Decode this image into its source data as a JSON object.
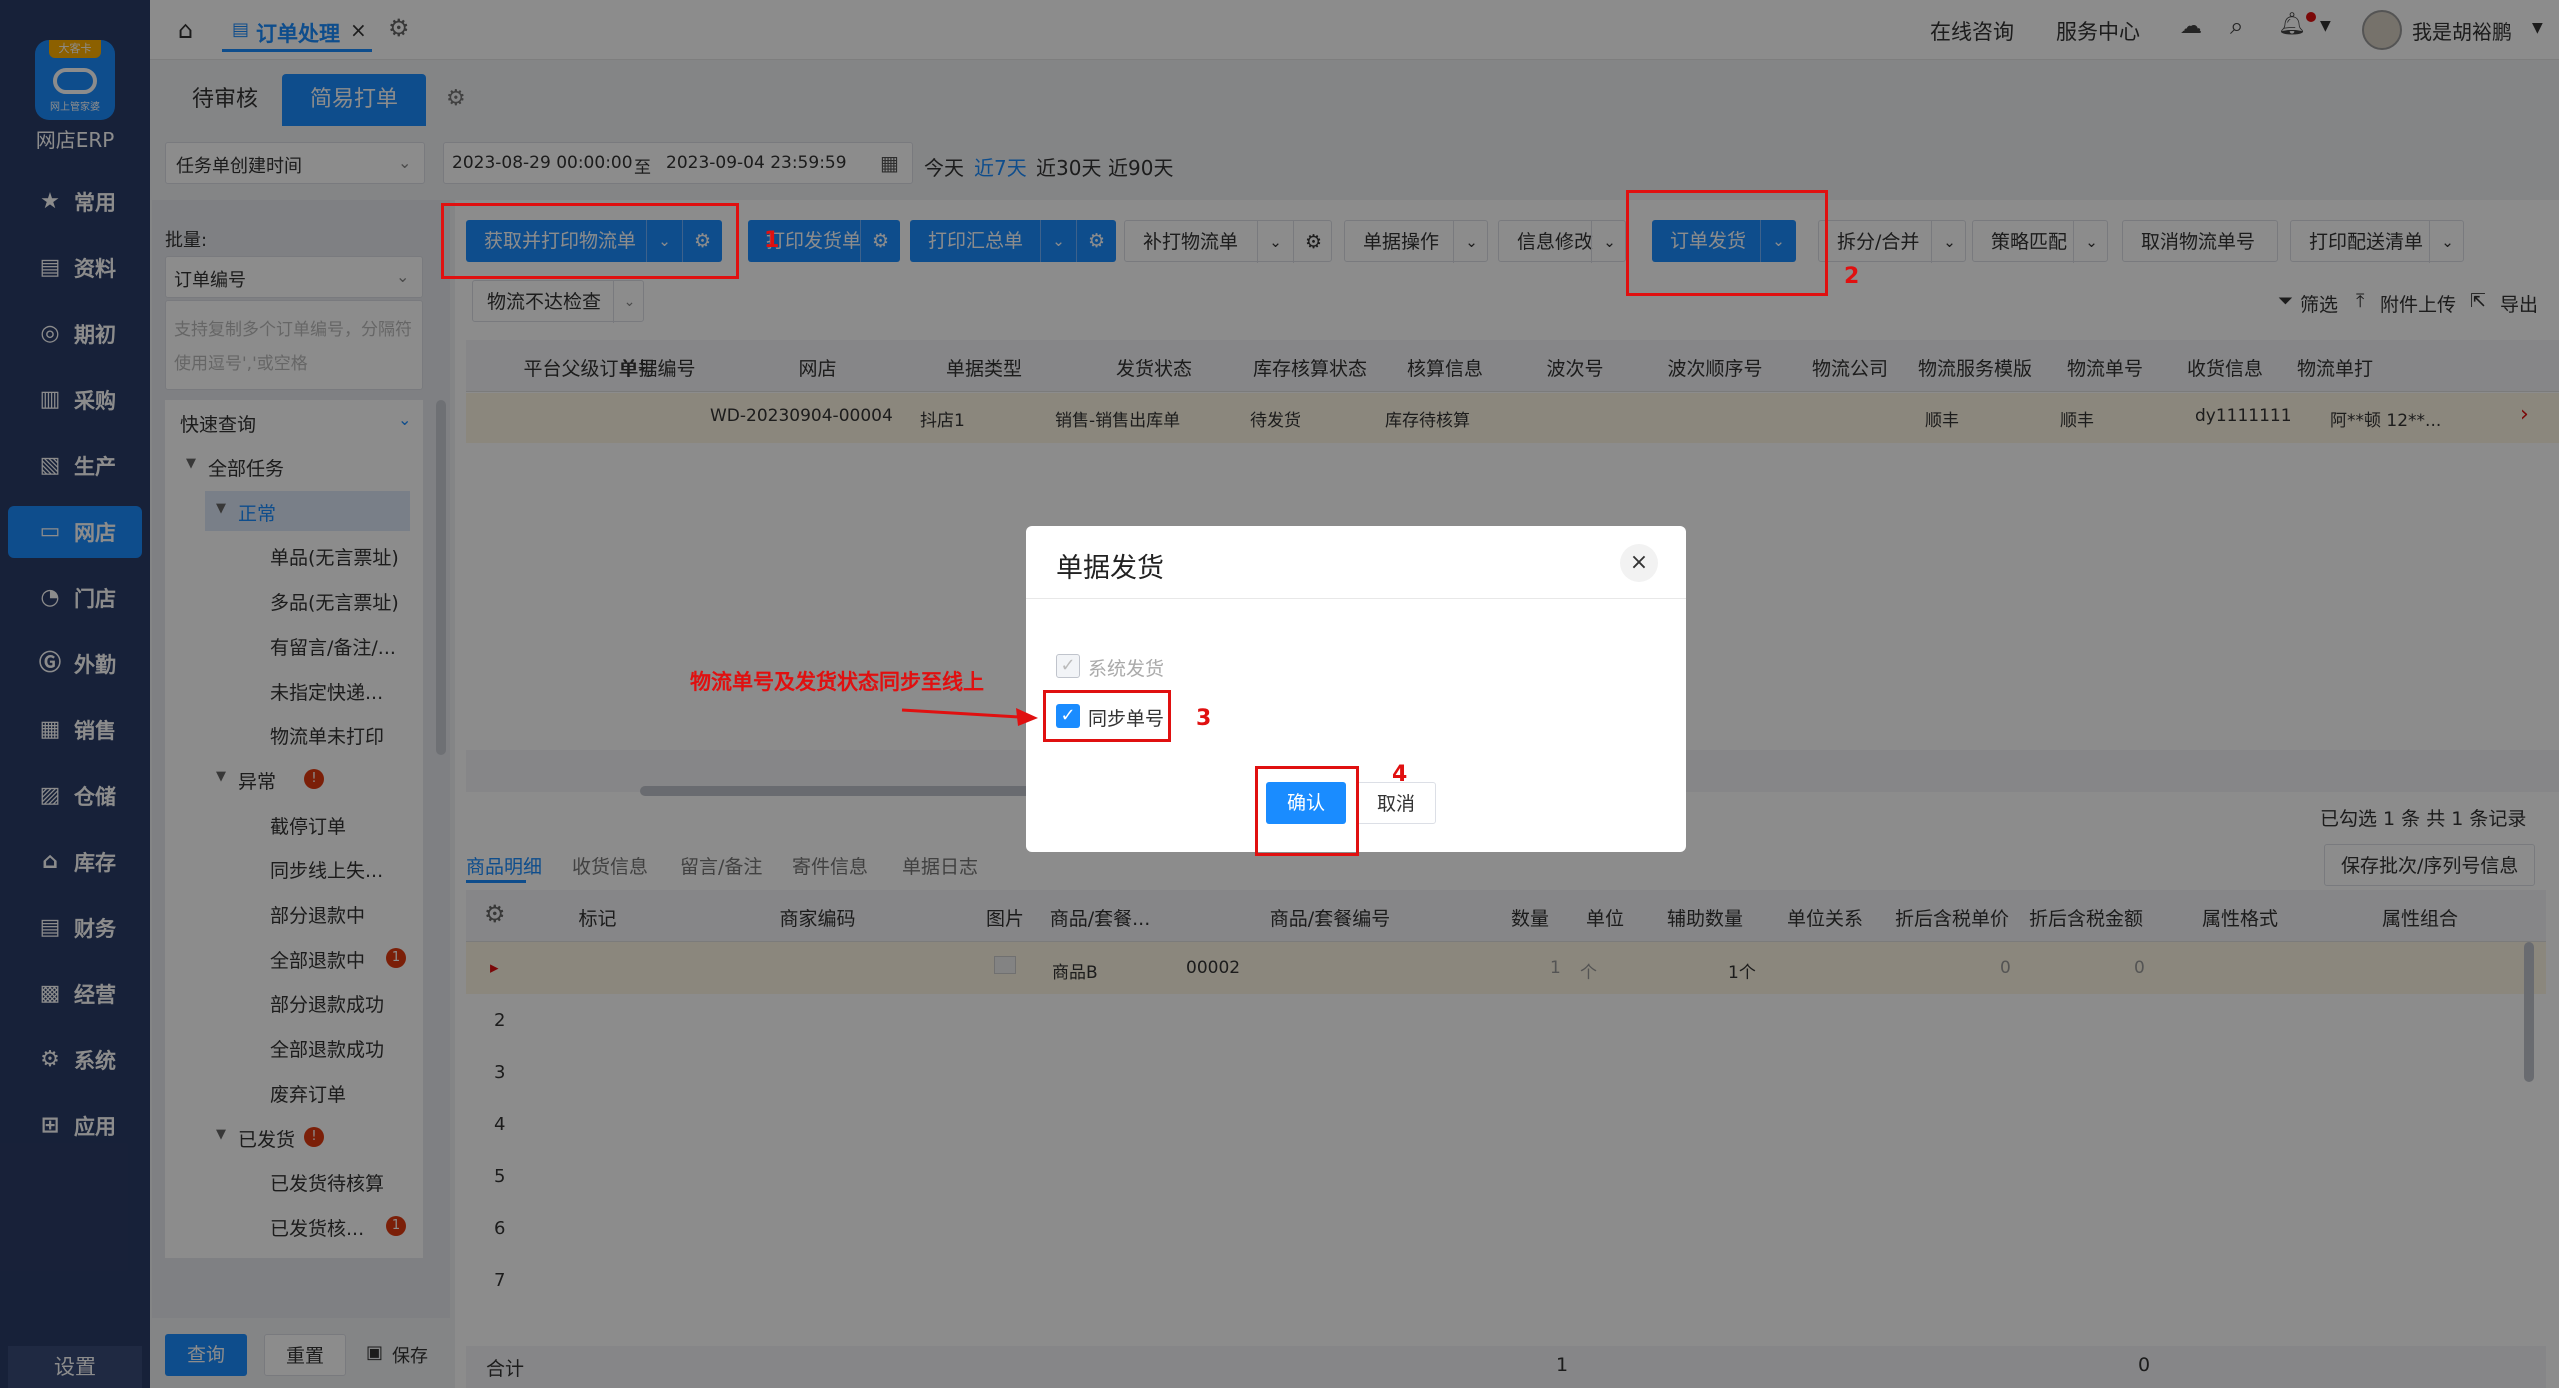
{
  "sidebar": {
    "logo_badge": "大客卡",
    "logo_sub": "网上管家婆",
    "app_name": "网店ERP",
    "items": [
      {
        "label": "常用",
        "icon": "star-icon",
        "active": false
      },
      {
        "label": "资料",
        "icon": "document-icon",
        "active": false
      },
      {
        "label": "期初",
        "icon": "target-icon",
        "active": false
      },
      {
        "label": "采购",
        "icon": "bar-chart-icon",
        "active": false
      },
      {
        "label": "生产",
        "icon": "file-icon",
        "active": false
      },
      {
        "label": "网店",
        "icon": "shop-icon",
        "active": true
      },
      {
        "label": "门店",
        "icon": "pie-icon",
        "active": false
      },
      {
        "label": "外勤",
        "icon": "g-icon",
        "active": false
      },
      {
        "label": "销售",
        "icon": "chart-icon",
        "active": false
      },
      {
        "label": "仓储",
        "icon": "warehouse-icon",
        "active": false
      },
      {
        "label": "库存",
        "icon": "home-icon",
        "active": false
      },
      {
        "label": "财务",
        "icon": "wallet-icon",
        "active": false
      },
      {
        "label": "经营",
        "icon": "image-icon",
        "active": false
      },
      {
        "label": "系统",
        "icon": "gear-icon",
        "active": false
      },
      {
        "label": "应用",
        "icon": "plus-icon",
        "active": false
      }
    ],
    "settings_label": "设置"
  },
  "topbar": {
    "tab_label": "订单处理",
    "online_consult": "在线咨询",
    "service_center": "服务中心",
    "user_name": "我是胡裕鹏"
  },
  "subtabs": [
    "待审核",
    "简易打单"
  ],
  "filters": {
    "date_type": "任务单创建时间",
    "date_start": "2023-08-29 00:00:00",
    "date_sep": "至",
    "date_end": "2023-09-04 23:59:59",
    "quick_dates": [
      "今天",
      "近7天",
      "近30天",
      "近90天"
    ]
  },
  "leftpanel": {
    "batch_label": "批量:",
    "order_field": "订单编号",
    "order_placeholder": "支持复制多个订单编号，分隔符使用逗号','或空格",
    "quick_query": "快速查询",
    "tree": [
      {
        "label": "全部任务",
        "level": 0,
        "toggle": "▼"
      },
      {
        "label": "正常",
        "level": 1,
        "toggle": "▼",
        "selected": true
      },
      {
        "label": "单品(无言票址)",
        "level": 2
      },
      {
        "label": "多品(无言票址)",
        "level": 2
      },
      {
        "label": "有留言/备注/...",
        "level": 2
      },
      {
        "label": "未指定快递...",
        "level": 2
      },
      {
        "label": "物流单未打印",
        "level": 2
      },
      {
        "label": "异常",
        "level": 1,
        "toggle": "▼",
        "badge": "!"
      },
      {
        "label": "截停订单",
        "level": 2
      },
      {
        "label": "同步线上失...",
        "level": 2
      },
      {
        "label": "部分退款中",
        "level": 2
      },
      {
        "label": "全部退款中",
        "level": 2,
        "badge": "1"
      },
      {
        "label": "部分退款成功",
        "level": 2
      },
      {
        "label": "全部退款成功",
        "level": 2
      },
      {
        "label": "废弃订单",
        "level": 2
      },
      {
        "label": "已发货",
        "level": 1,
        "toggle": "▼",
        "badge": "!"
      },
      {
        "label": "已发货待核算",
        "level": 2
      },
      {
        "label": "已发货核...",
        "level": 2,
        "badge": "1"
      }
    ],
    "query_btn": "查询",
    "reset_btn": "重置",
    "save_btn": "保存"
  },
  "toolbar": {
    "row1": [
      "获取并打印物流单",
      "打印发货单",
      "打印汇总单",
      "补打物流单",
      "单据操作",
      "信息修改",
      "订单发货",
      "拆分/合并",
      "策略匹配",
      "取消物流单号",
      "打印配送清单"
    ],
    "row2": [
      "物流不达检查"
    ],
    "filter": "筛选",
    "upload": "附件上传",
    "export": "导出"
  },
  "main_table": {
    "columns": [
      "平台父级订单号",
      "单据编号",
      "网店",
      "单据类型",
      "发货状态",
      "库存核算状态",
      "核算信息",
      "波次号",
      "波次顺序号",
      "物流公司",
      "物流服务模版",
      "物流单号",
      "收货信息",
      "物流单打"
    ],
    "rows": [
      [
        "",
        "WD-20230904-00004",
        "抖店1",
        "销售-销售出库单",
        "待发货",
        "库存待核算",
        "",
        "",
        "",
        "顺丰",
        "顺丰",
        "dy1111111",
        "阿**顿  12**..."
      ]
    ],
    "summary": "已勾选 1 条 共 1 条记录"
  },
  "detail": {
    "tabs": [
      "商品明细",
      "收货信息",
      "留言/备注",
      "寄件信息",
      "单据日志"
    ],
    "save_batch_btn": "保存批次/序列号信息",
    "columns": [
      "标记",
      "商家编码",
      "图片",
      "商品/套餐...",
      "商品/套餐编号",
      "数量",
      "单位",
      "辅助数量",
      "单位关系",
      "折后含税单价",
      "折后含税金额",
      "属性格式",
      "属性组合"
    ],
    "rows": [
      {
        "index": "▸",
        "name": "商品B",
        "code": "00002",
        "qty": "1",
        "unit": "个",
        "aux_qty": "1个",
        "price": "0",
        "amount": "0"
      }
    ],
    "row_numbers": [
      "2",
      "3",
      "4",
      "5",
      "6",
      "7"
    ],
    "total_label": "合计",
    "total_qty": "1",
    "total_amount": "0"
  },
  "annotations": {
    "n1": "1",
    "n2": "2",
    "n3": "3",
    "n4": "4",
    "note": "物流单号及发货状态同步至线上"
  },
  "modal": {
    "title": "单据发货",
    "options": [
      {
        "label": "系统发货",
        "checked": true,
        "disabled": true
      },
      {
        "label": "同步单号",
        "checked": true,
        "disabled": false
      }
    ],
    "confirm": "确认",
    "cancel": "取消"
  }
}
